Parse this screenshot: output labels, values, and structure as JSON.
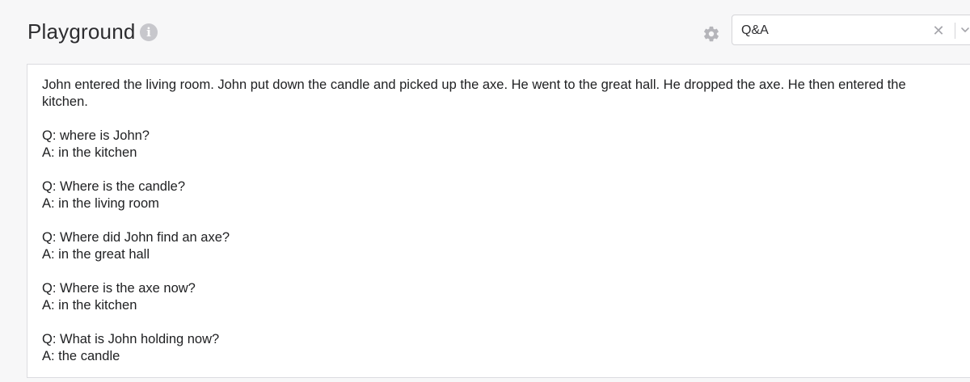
{
  "header": {
    "title": "Playground",
    "info_icon": "info-icon",
    "settings_icon": "gear-icon"
  },
  "preset": {
    "selected": "Q&A",
    "clear_icon": "close-icon",
    "dropdown_icon": "chevron-down-icon"
  },
  "prompt": {
    "text": "John entered the living room. John put down the candle and picked up the axe. He went to the great hall. He dropped the axe. He then entered the\nkitchen.\n\nQ: where is John?\nA: in the kitchen\n\nQ: Where is the candle?\nA: in the living room\n\nQ: Where did John find an axe?\nA: in the great hall\n\nQ: Where is the axe now?\nA: in the kitchen\n\nQ: What is John holding now?\nA: the candle"
  },
  "colors": {
    "page_bg": "#f7f7f8",
    "panel_bg": "#ffffff",
    "border": "#dcdce0",
    "icon_gray": "#c7c7cc"
  }
}
